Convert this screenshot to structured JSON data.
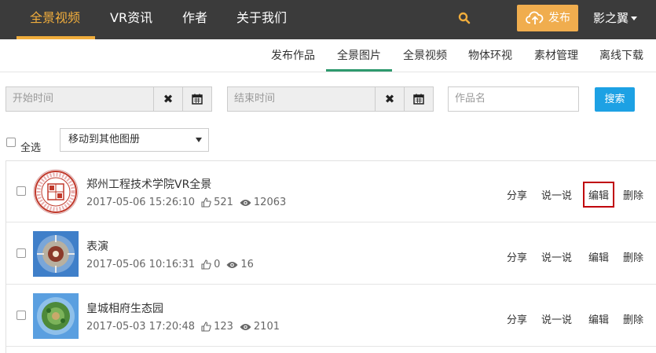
{
  "topnav": {
    "items": [
      "全景视频",
      "VR资讯",
      "作者",
      "关于我们"
    ],
    "publish_label": "发布",
    "user_name": "影之翼",
    "colors": {
      "bar": "#3b3b3b",
      "accent": "#f0ad3c",
      "publish": "#f0ad4e"
    }
  },
  "subtabs": [
    "发布作品",
    "全景图片",
    "全景视频",
    "物体环视",
    "素材管理",
    "离线下载"
  ],
  "filters": {
    "start_placeholder": "开始时间",
    "end_placeholder": "结束时间",
    "name_placeholder": "作品名",
    "search_label": "搜索",
    "clear_symbol": "✖"
  },
  "bulk": {
    "select_all_label": "全选",
    "move_option": "移动到其他图册"
  },
  "works": [
    {
      "title": "郑州工程技术学院VR全景",
      "date": "2017-05-06 15:26:10",
      "likes": "521",
      "views": "12063",
      "thumb_icon": "university-seal-icon"
    },
    {
      "title": "表演",
      "date": "2017-05-06 10:16:31",
      "likes": "0",
      "views": "16",
      "thumb_icon": "panorama-planet-icon"
    },
    {
      "title": "皇城相府生态园",
      "date": "2017-05-03 17:20:48",
      "likes": "123",
      "views": "2101",
      "thumb_icon": "panorama-planet-icon"
    }
  ],
  "row_actions": {
    "share": "分享",
    "comment": "说一说",
    "edit": "编辑",
    "delete": "删除"
  }
}
